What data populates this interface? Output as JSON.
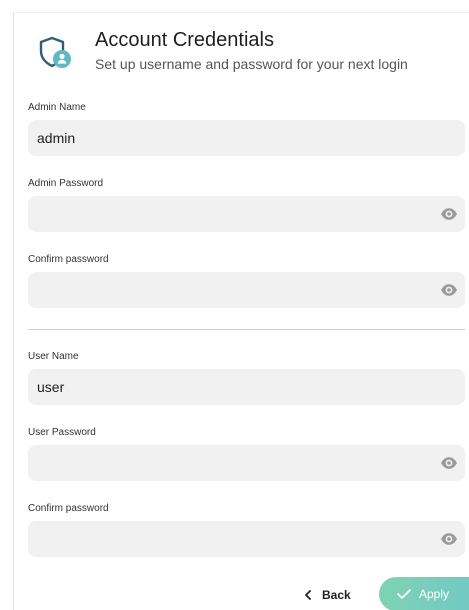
{
  "header": {
    "title": "Account Credentials",
    "subtitle": "Set up username and password for your next login",
    "icon": "shield-user-icon"
  },
  "admin": {
    "name_label": "Admin Name",
    "name_value": "admin",
    "password_label": "Admin Password",
    "password_value": "",
    "confirm_label": "Confirm password",
    "confirm_value": ""
  },
  "user": {
    "name_label": "User Name",
    "name_value": "user",
    "password_label": "User Password",
    "password_value": "",
    "confirm_label": "Confirm password",
    "confirm_value": ""
  },
  "actions": {
    "back_label": "Back",
    "apply_label": "Apply"
  },
  "colors": {
    "accent": "#5fb8c4",
    "field_bg": "#f1f1f1",
    "apply_gradient_start": "#7fd3b3",
    "apply_gradient_end": "#73c9c4",
    "eye_icon": "#9a9a9a"
  }
}
